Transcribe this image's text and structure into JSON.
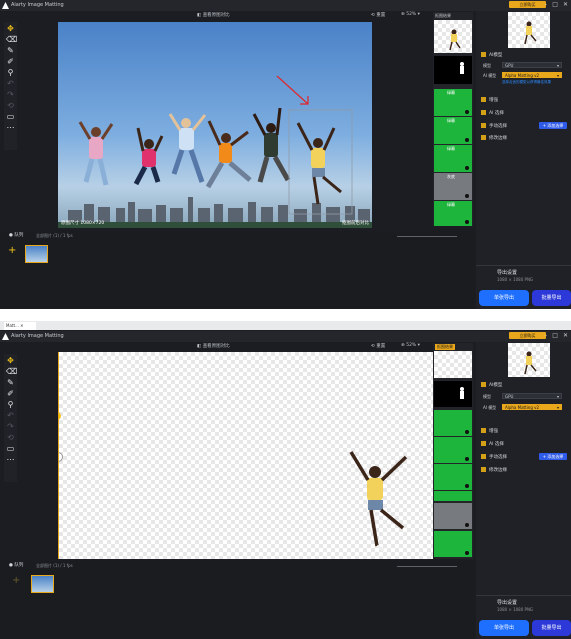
{
  "app": {
    "title": "Aiarty Image Matting",
    "register_chip": "立即购买",
    "window_controls": [
      "–",
      "□",
      "✕"
    ]
  },
  "toolbar": {
    "compare_label": "查看原图对比",
    "zoom": "52%",
    "undo_label": "撤销",
    "reset_label": "重置"
  },
  "tools": [
    "move-icon",
    "eraser-icon",
    "brush-icon",
    "brush-small-icon",
    "magic-wand-icon",
    "undo-icon",
    "redo-icon",
    "reset-icon",
    "crop-icon",
    "info-icon"
  ],
  "screens": [
    {
      "canvas_caption_left": "原图尺寸 1080×720",
      "canvas_caption_right": "抠图前后对比",
      "thumbs_header": "抠图结果",
      "thumb_labels": [
        "透明",
        "背景",
        "绿幕",
        "绿幕",
        "绿幕",
        "灰底",
        "绿幕"
      ],
      "panel": {
        "model_section": "AI模型",
        "model_label": "模型",
        "model_value": "GPU",
        "ai_model_label": "AI 模型",
        "ai_model_value": "Alpha Matting v2",
        "model_tip": "选择合适的模型以获得最佳效果",
        "rows": [
          "增强",
          "AI 选择",
          "手动选择",
          "修改边缘"
        ],
        "manual_button": "+ 添加选择"
      },
      "bottom": {
        "plus_label": "+",
        "queue_label": "队列",
        "queue_sub": "全部图片 (1) / 1 fps",
        "export_title": "导出设置",
        "export_sub": "1080 × 1080 PNG",
        "single_export": "单张导出",
        "batch_export": "批量导出"
      }
    },
    {
      "tab_label": "Matt...",
      "canvas_caption_left": "",
      "canvas_caption_right": "",
      "thumbs_header": "抠图结果",
      "panel": {
        "model_section": "AI模型",
        "model_label": "模型",
        "model_value": "GPU",
        "ai_model_label": "AI 模型",
        "ai_model_value": "Alpha Matting v2",
        "rows": [
          "增强",
          "AI 选择",
          "手动选择",
          "修改边缘"
        ],
        "manual_button": "+ 添加选择"
      },
      "bottom": {
        "queue_label": "队列",
        "queue_sub": "全部图片 (1) / 1 fps",
        "export_title": "导出设置",
        "export_sub": "1080 × 1080 PNG",
        "single_export": "单张导出",
        "batch_export": "批量导出"
      }
    }
  ]
}
